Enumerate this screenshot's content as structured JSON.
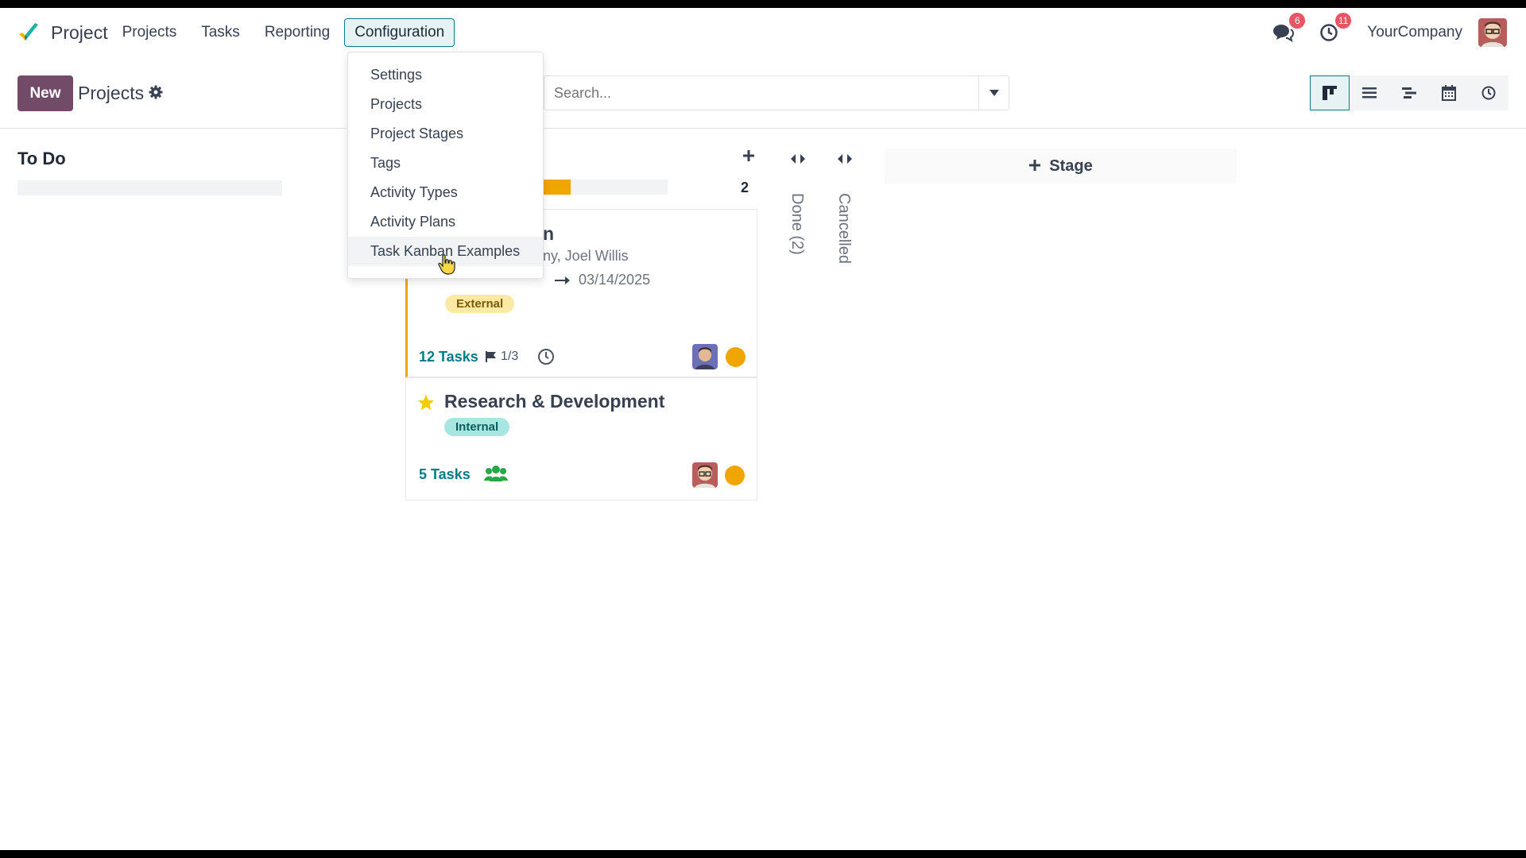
{
  "app": {
    "brand_name": "Project"
  },
  "nav": {
    "menu": [
      "Projects",
      "Tasks",
      "Reporting",
      "Configuration"
    ],
    "active_menu": "Configuration",
    "messages_badge": "6",
    "activities_badge": "11",
    "company": "YourCompany"
  },
  "control_panel": {
    "new_label": "New",
    "breadcrumb": "Projects",
    "search_placeholder": "Search...",
    "views": [
      "kanban-icon",
      "list-icon",
      "gantt-icon",
      "calendar-icon",
      "activity-icon"
    ],
    "active_view": "kanban-icon"
  },
  "configuration_menu": {
    "items": [
      "Settings",
      "Projects",
      "Project Stages",
      "Tags",
      "Activity Types",
      "Activity Plans",
      "Task Kanban Examples"
    ],
    "hovered": "Task Kanban Examples"
  },
  "kanban": {
    "columns": [
      {
        "title": "To Do"
      },
      {
        "count": "2",
        "progress_fraction": 0.63
      }
    ],
    "cards": [
      {
        "title_partial": "n",
        "customer_partial": "ny, Joel Willis",
        "date": "03/14/2025",
        "tag": "External",
        "tasks_label": "12 Tasks",
        "milestones": "1/3",
        "status_color": "#f0a500"
      },
      {
        "title": "Research & Development",
        "tag": "Internal",
        "tasks_label": "5 Tasks",
        "favorite": true,
        "status_color": "#f0a500"
      }
    ],
    "folded_columns": [
      "Done (2)",
      "Cancelled"
    ],
    "add_stage_label": "Stage"
  },
  "colors": {
    "accent": "#017e84",
    "primary_button": "#714b67",
    "progress": "#f0a500",
    "badge": "#e45763"
  }
}
